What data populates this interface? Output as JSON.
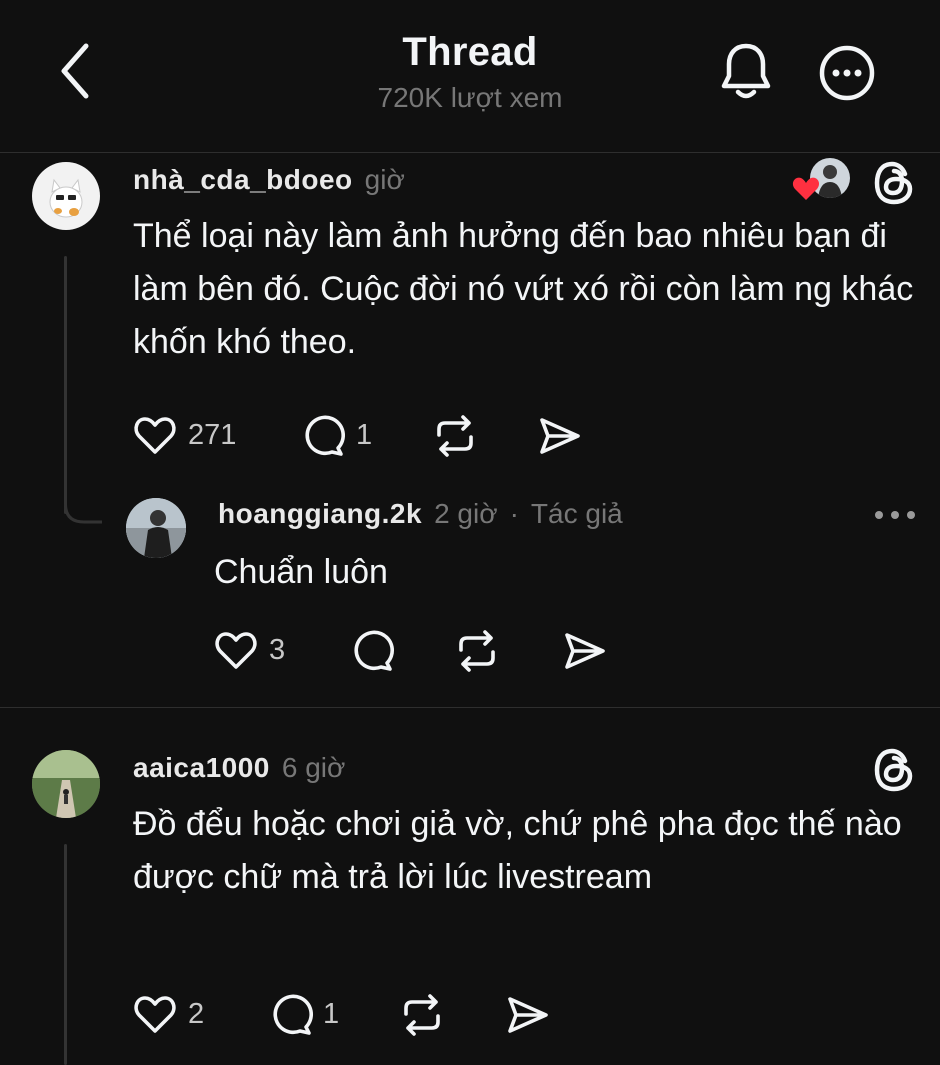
{
  "header": {
    "title": "Thread",
    "subtitle": "720K lượt xem"
  },
  "comments": [
    {
      "username": "nhà_cda_bdoeo",
      "time": "giờ",
      "text": "Thể loại này làm ảnh hưởng đến bao nhiêu bạn đi làm bên đó. Cuộc đời nó vứt xó rồi còn làm ng khác khốn khó theo.",
      "likes": "271",
      "replies": "1",
      "liked_by_author": true
    },
    {
      "username": "hoanggiang.2k",
      "time": "2 giờ",
      "author_tag": "Tác giả",
      "text": "Chuẩn luôn",
      "likes": "3"
    },
    {
      "username": "aaica1000",
      "time": "6 giờ",
      "text": "Đồ đểu hoặc chơi giả vờ, chứ phê pha đọc thế nào được chữ mà trả lời lúc livestream",
      "likes": "2",
      "replies": "1"
    }
  ],
  "colors": {
    "background": "#101010",
    "text_primary": "#f3f5f7",
    "text_secondary": "#777777",
    "heart_red": "#ff3040",
    "divider": "#2e2e2e"
  },
  "icons": {
    "back": "chevron-left-icon",
    "notifications": "bell-icon",
    "more": "more-circle-icon",
    "threads": "threads-logo-icon",
    "like": "heart-icon",
    "reply": "comment-icon",
    "repost": "repost-icon",
    "share": "send-icon"
  }
}
